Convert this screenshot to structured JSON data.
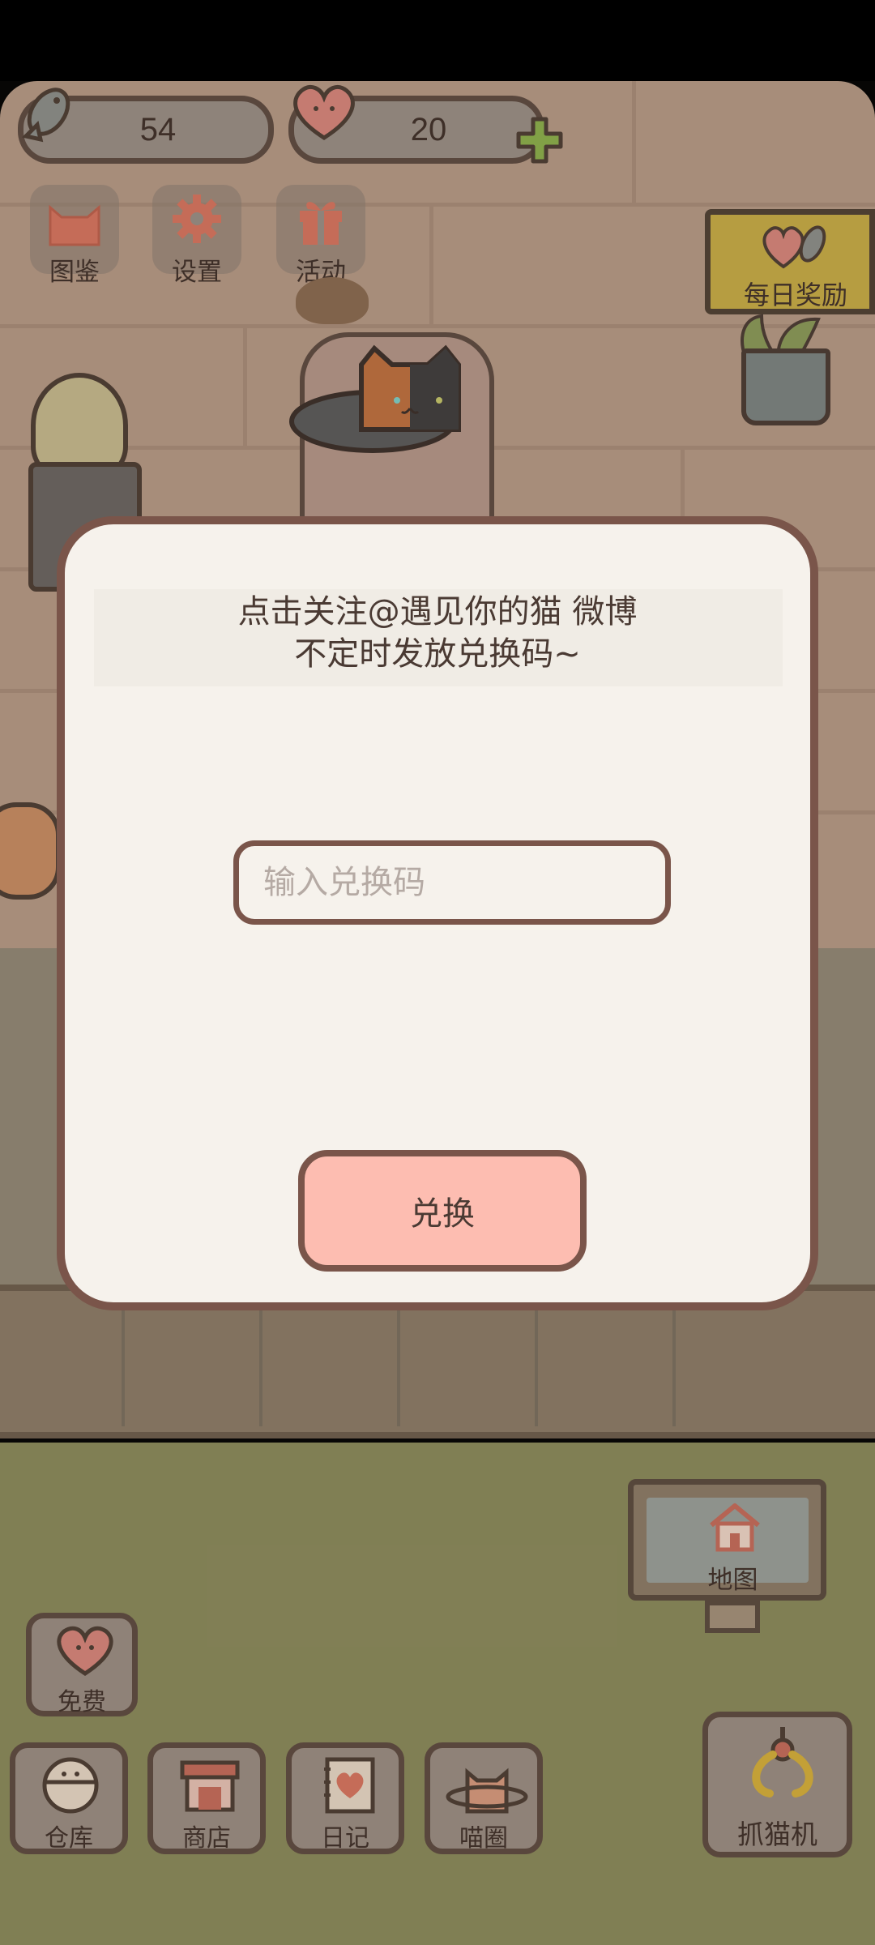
{
  "resources": {
    "fish_count": "54",
    "heart_count": "20"
  },
  "top_menu": {
    "catalog_label": "图鉴",
    "settings_label": "设置",
    "events_label": "活动"
  },
  "daily_reward": {
    "label": "每日奖励"
  },
  "map": {
    "label": "地图"
  },
  "bottom_bar": {
    "free_label": "免费",
    "warehouse_label": "仓库",
    "shop_label": "商店",
    "diary_label": "日记",
    "circle_label": "喵圈",
    "claw_machine_label": "抓猫机"
  },
  "dialog": {
    "title_line1": "点击关注@遇见你的猫 微博",
    "title_line2": "不定时发放兑换码~",
    "input_value": "",
    "input_placeholder": "输入兑换码",
    "redeem_button_label": "兑换"
  },
  "colors": {
    "wall": "#b79a86",
    "grass": "#8a8a5a",
    "dialog_bg": "#f6f2ec",
    "dialog_border": "#7a554a",
    "redeem_button": "#fdbdb1",
    "heart": "#d9867c",
    "plus": "#8bb04a",
    "flag": "#c8ac45"
  }
}
